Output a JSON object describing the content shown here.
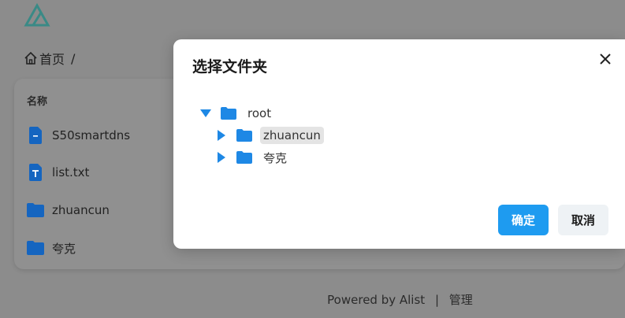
{
  "app": {
    "logo_name": "alist-logo"
  },
  "breadcrumb": {
    "home_label": "首页",
    "separator": "/"
  },
  "file_list": {
    "column_name": "名称",
    "items": [
      {
        "name": "S50smartdns",
        "icon": "file-icon"
      },
      {
        "name": "list.txt",
        "icon": "text-file-icon"
      },
      {
        "name": "zhuancun",
        "icon": "folder-icon"
      },
      {
        "name": "夸克",
        "icon": "folder-icon"
      }
    ]
  },
  "footer": {
    "powered_by": "Powered by Alist",
    "separator": "|",
    "manage_link": "管理"
  },
  "modal": {
    "title": "选择文件夹",
    "tree": {
      "root": {
        "label": "root",
        "expanded": true
      },
      "children": [
        {
          "label": "zhuancun",
          "selected": true,
          "expanded": false
        },
        {
          "label": "夸克",
          "selected": false,
          "expanded": false
        }
      ]
    },
    "confirm_label": "确定",
    "cancel_label": "取消"
  },
  "colors": {
    "accent": "#1e9bf0",
    "folder": "#1e88e5",
    "overlay": "#8c8c8c"
  }
}
